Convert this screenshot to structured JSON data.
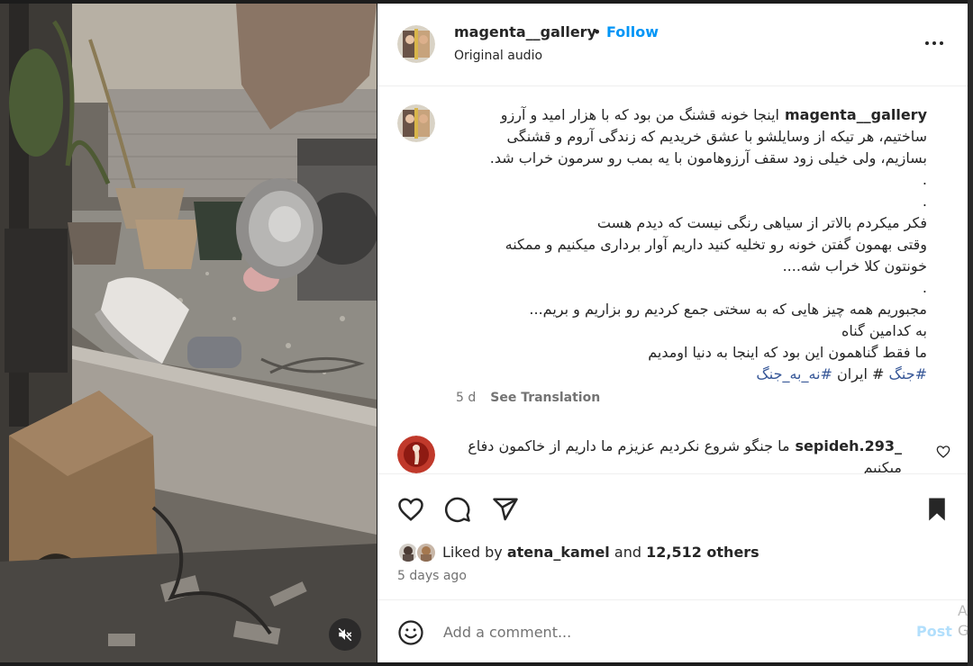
{
  "post": {
    "username": "magenta__gallery",
    "separator": "•",
    "follow_label": "Follow",
    "audio_label": "Original audio",
    "more_icon": "more-options-icon"
  },
  "caption": {
    "username": "magenta__gallery",
    "lines": [
      "اینجا خونه قشنگ من بود که با هزار امید و آرزو",
      "ساختیم، هر تیکه از وسایلشو با عشق خریدیم که زندگی آروم و قشنگی",
      "بسازیم، ولی خیلی زود سقف آرزوهامون با یه بمب رو سرمون خراب شد.",
      ".",
      ".",
      "فکر میکردم بالاتر از سیاهی رنگی نیست که دیدم هست",
      "وقتی بهمون گفتن خونه رو تخلیه کنید داریم آوار برداری میکنیم و ممکنه",
      "خونتون کلا خراب شه....",
      ".",
      "مجبوریم همه چیز هایی که به سختی جمع کردیم رو بزاریم و بریم...",
      "به کدامین گناه",
      "ما فقط گناهمون این بود که اینجا به دنیا اومدیم"
    ],
    "tags": {
      "tag1": "#جنگ",
      "hash": "#",
      "word": "ایران",
      "tag2": "#نه_به_جنگ"
    },
    "age": "5 d",
    "see_translation": "See Translation"
  },
  "comment": {
    "username": "sepideh.293_",
    "text": "ما جنگو شروع نکردیم عزیزم ما داریم از خاکمون دفاع میکنیم"
  },
  "likes": {
    "prefix": "Liked by",
    "user": "atena_kamel",
    "and": "and",
    "others": "12,512 others"
  },
  "posted": "5 days ago",
  "add_comment": {
    "placeholder": "Add a comment...",
    "post_label": "Post"
  },
  "edge_text": "A G",
  "colors": {
    "link_blue": "#0095f6",
    "hashtag_blue": "#385898",
    "post_disabled": "#b2dffc",
    "text": "#262626",
    "muted": "#737373"
  },
  "icons": [
    "heart-icon",
    "comment-icon",
    "share-icon",
    "bookmark-icon",
    "emoji-icon",
    "muted-speaker-icon"
  ]
}
